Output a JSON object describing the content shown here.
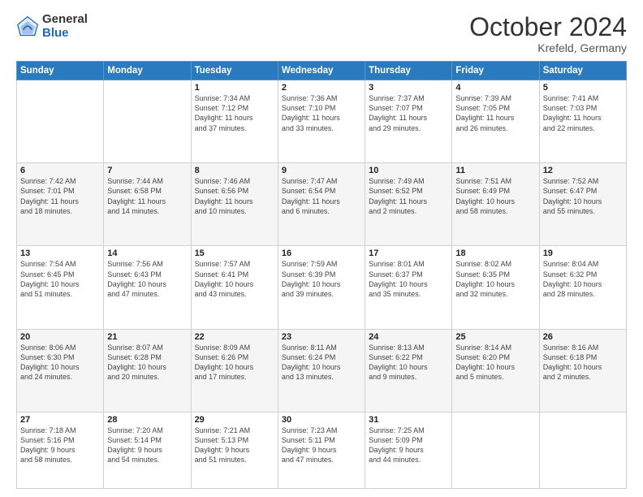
{
  "header": {
    "logo_general": "General",
    "logo_blue": "Blue",
    "month_title": "October 2024",
    "location": "Krefeld, Germany"
  },
  "weekdays": [
    "Sunday",
    "Monday",
    "Tuesday",
    "Wednesday",
    "Thursday",
    "Friday",
    "Saturday"
  ],
  "weeks": [
    [
      {
        "day": "",
        "info": ""
      },
      {
        "day": "",
        "info": ""
      },
      {
        "day": "1",
        "info": "Sunrise: 7:34 AM\nSunset: 7:12 PM\nDaylight: 11 hours\nand 37 minutes."
      },
      {
        "day": "2",
        "info": "Sunrise: 7:36 AM\nSunset: 7:10 PM\nDaylight: 11 hours\nand 33 minutes."
      },
      {
        "day": "3",
        "info": "Sunrise: 7:37 AM\nSunset: 7:07 PM\nDaylight: 11 hours\nand 29 minutes."
      },
      {
        "day": "4",
        "info": "Sunrise: 7:39 AM\nSunset: 7:05 PM\nDaylight: 11 hours\nand 26 minutes."
      },
      {
        "day": "5",
        "info": "Sunrise: 7:41 AM\nSunset: 7:03 PM\nDaylight: 11 hours\nand 22 minutes."
      }
    ],
    [
      {
        "day": "6",
        "info": "Sunrise: 7:42 AM\nSunset: 7:01 PM\nDaylight: 11 hours\nand 18 minutes."
      },
      {
        "day": "7",
        "info": "Sunrise: 7:44 AM\nSunset: 6:58 PM\nDaylight: 11 hours\nand 14 minutes."
      },
      {
        "day": "8",
        "info": "Sunrise: 7:46 AM\nSunset: 6:56 PM\nDaylight: 11 hours\nand 10 minutes."
      },
      {
        "day": "9",
        "info": "Sunrise: 7:47 AM\nSunset: 6:54 PM\nDaylight: 11 hours\nand 6 minutes."
      },
      {
        "day": "10",
        "info": "Sunrise: 7:49 AM\nSunset: 6:52 PM\nDaylight: 11 hours\nand 2 minutes."
      },
      {
        "day": "11",
        "info": "Sunrise: 7:51 AM\nSunset: 6:49 PM\nDaylight: 10 hours\nand 58 minutes."
      },
      {
        "day": "12",
        "info": "Sunrise: 7:52 AM\nSunset: 6:47 PM\nDaylight: 10 hours\nand 55 minutes."
      }
    ],
    [
      {
        "day": "13",
        "info": "Sunrise: 7:54 AM\nSunset: 6:45 PM\nDaylight: 10 hours\nand 51 minutes."
      },
      {
        "day": "14",
        "info": "Sunrise: 7:56 AM\nSunset: 6:43 PM\nDaylight: 10 hours\nand 47 minutes."
      },
      {
        "day": "15",
        "info": "Sunrise: 7:57 AM\nSunset: 6:41 PM\nDaylight: 10 hours\nand 43 minutes."
      },
      {
        "day": "16",
        "info": "Sunrise: 7:59 AM\nSunset: 6:39 PM\nDaylight: 10 hours\nand 39 minutes."
      },
      {
        "day": "17",
        "info": "Sunrise: 8:01 AM\nSunset: 6:37 PM\nDaylight: 10 hours\nand 35 minutes."
      },
      {
        "day": "18",
        "info": "Sunrise: 8:02 AM\nSunset: 6:35 PM\nDaylight: 10 hours\nand 32 minutes."
      },
      {
        "day": "19",
        "info": "Sunrise: 8:04 AM\nSunset: 6:32 PM\nDaylight: 10 hours\nand 28 minutes."
      }
    ],
    [
      {
        "day": "20",
        "info": "Sunrise: 8:06 AM\nSunset: 6:30 PM\nDaylight: 10 hours\nand 24 minutes."
      },
      {
        "day": "21",
        "info": "Sunrise: 8:07 AM\nSunset: 6:28 PM\nDaylight: 10 hours\nand 20 minutes."
      },
      {
        "day": "22",
        "info": "Sunrise: 8:09 AM\nSunset: 6:26 PM\nDaylight: 10 hours\nand 17 minutes."
      },
      {
        "day": "23",
        "info": "Sunrise: 8:11 AM\nSunset: 6:24 PM\nDaylight: 10 hours\nand 13 minutes."
      },
      {
        "day": "24",
        "info": "Sunrise: 8:13 AM\nSunset: 6:22 PM\nDaylight: 10 hours\nand 9 minutes."
      },
      {
        "day": "25",
        "info": "Sunrise: 8:14 AM\nSunset: 6:20 PM\nDaylight: 10 hours\nand 5 minutes."
      },
      {
        "day": "26",
        "info": "Sunrise: 8:16 AM\nSunset: 6:18 PM\nDaylight: 10 hours\nand 2 minutes."
      }
    ],
    [
      {
        "day": "27",
        "info": "Sunrise: 7:18 AM\nSunset: 5:16 PM\nDaylight: 9 hours\nand 58 minutes."
      },
      {
        "day": "28",
        "info": "Sunrise: 7:20 AM\nSunset: 5:14 PM\nDaylight: 9 hours\nand 54 minutes."
      },
      {
        "day": "29",
        "info": "Sunrise: 7:21 AM\nSunset: 5:13 PM\nDaylight: 9 hours\nand 51 minutes."
      },
      {
        "day": "30",
        "info": "Sunrise: 7:23 AM\nSunset: 5:11 PM\nDaylight: 9 hours\nand 47 minutes."
      },
      {
        "day": "31",
        "info": "Sunrise: 7:25 AM\nSunset: 5:09 PM\nDaylight: 9 hours\nand 44 minutes."
      },
      {
        "day": "",
        "info": ""
      },
      {
        "day": "",
        "info": ""
      }
    ]
  ]
}
